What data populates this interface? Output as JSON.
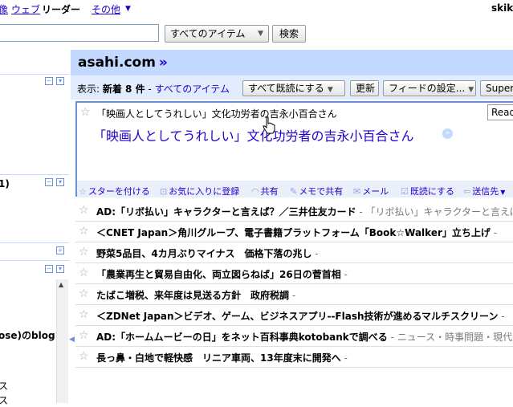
{
  "topnav": {
    "images": "像",
    "web": "ウェブ",
    "reader": "リーダー",
    "more": "その他",
    "more_caret": "▼",
    "user": "skik"
  },
  "search": {
    "scope": "すべてのアイテム",
    "button": "検索",
    "caret": "▼"
  },
  "sidebar": {
    "frag1": ")",
    "frag2": "1)",
    "frag3": "ose)のblog",
    "frag4": "ス",
    "frag5": "ス"
  },
  "feed": {
    "title": "asahi.com",
    "title_arrow": "»"
  },
  "viewbar": {
    "label": "表示:",
    "new_count": "新着 8 件",
    "dash": " - ",
    "all_items": "すべてのアイテム",
    "mark_all_read": "すべて既読にする",
    "refresh": "更新",
    "feed_settings": "フィードの設定...",
    "super": "Super",
    "caret": "▼"
  },
  "entry": {
    "star": "☆",
    "head_title": "「映画人としてうれしい」文化功労者の吉永小百合さん",
    "read_btn": "Read",
    "title": "「映画人としてうれしい」文化功労者の吉永小百合さん",
    "title_icon": "»",
    "actions": [
      {
        "icon": "☆",
        "label": "スターを付ける"
      },
      {
        "icon": "⊡",
        "label": "お気に入りに登録"
      },
      {
        "icon": "◠",
        "label": "共有"
      },
      {
        "icon": "✎",
        "label": "メモで共有"
      },
      {
        "icon": "✉",
        "label": "メール"
      },
      {
        "icon": "☑",
        "label": "既読にする"
      },
      {
        "icon": "⇦",
        "label": "送信先"
      }
    ],
    "actions_caret": "▼"
  },
  "items": [
    {
      "title": "AD:「リボ払い」キャラクターと言えば？／三井住友カード",
      "snippet": " - 「リボ払い」キャラクターと言えば？／三井住友カード"
    },
    {
      "title": "＜CNET Japan＞角川グループ、電子書籍プラットフォーム「Book☆Walker」立ち上げ",
      "snippet": " - "
    },
    {
      "title": "野菜5品目、4カ月ぶりマイナス　価格下落の兆し",
      "snippet": " - "
    },
    {
      "title": "「農業再生と貿易自由化、両立図らねば」26日の菅首相",
      "snippet": " - "
    },
    {
      "title": "たばこ増税、来年度は見送る方針　政府税調",
      "snippet": " - "
    },
    {
      "title": "＜ZDNet Japan＞ビデオ、ゲーム、ビジネスアプリ--Flash技術が進めるマルチスクリーン",
      "snippet": " - "
    },
    {
      "title": "AD:「ホームムービーの日」をネット百科事典kotobankで調べる",
      "snippet": " - ニュース・時事問題・現代用語"
    },
    {
      "title": "長っ鼻・白地で軽快感　リニア車両、13年度末に開発へ",
      "snippet": " - "
    }
  ]
}
